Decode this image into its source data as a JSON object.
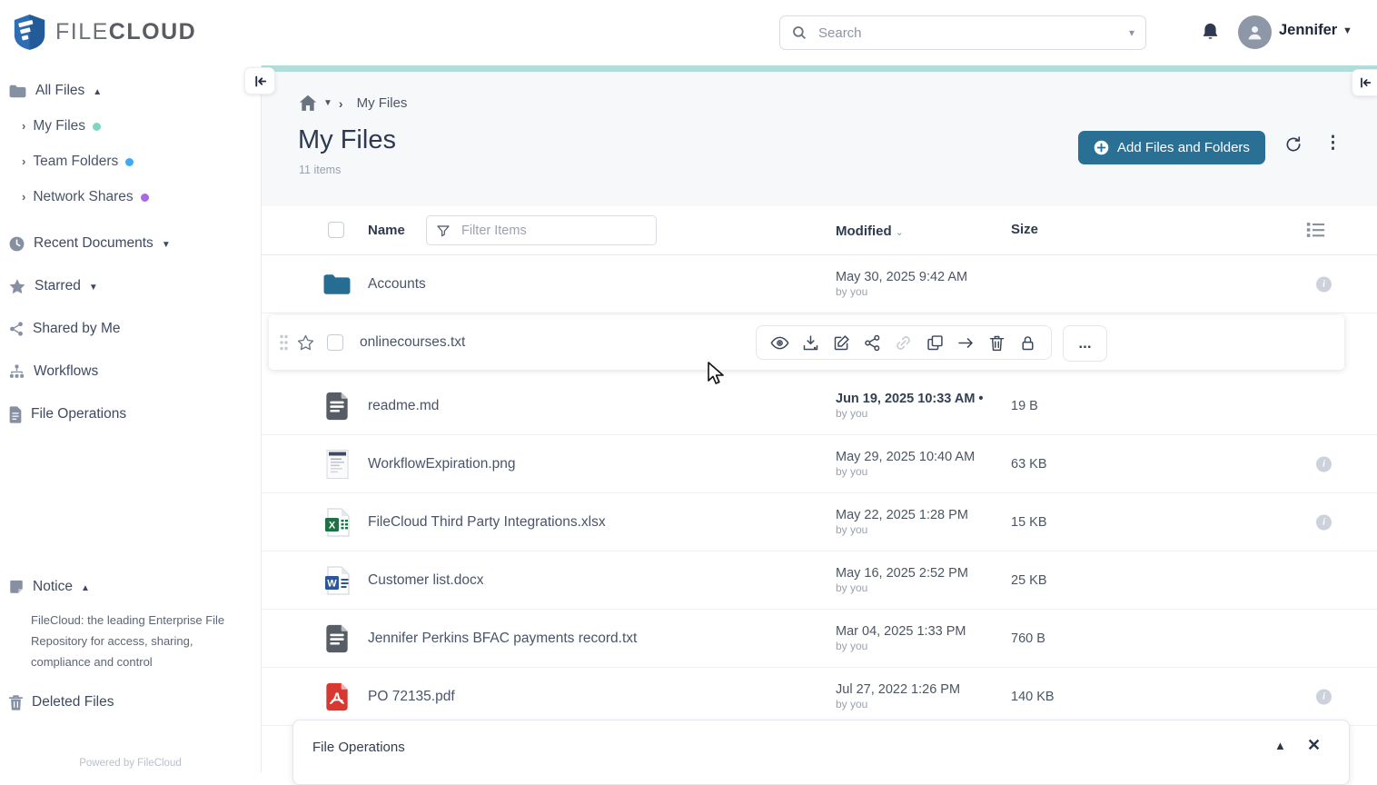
{
  "colors": {
    "primary": "#2a7095",
    "teal_bar": "#b0dfdb",
    "folder_icon": "#256d92"
  },
  "header": {
    "brand_file": "FILE",
    "brand_cloud": "CLOUD",
    "search_placeholder": "Search",
    "user_name": "Jennifer"
  },
  "sidebar": {
    "all_files": {
      "label": "All Files"
    },
    "tree": [
      {
        "label": "My Files",
        "dot": "#7fd6c0"
      },
      {
        "label": "Team Folders",
        "dot": "#3fa9f5"
      },
      {
        "label": "Network Shares",
        "dot": "#a868e8"
      }
    ],
    "items": [
      {
        "label": "Recent Documents"
      },
      {
        "label": "Starred"
      },
      {
        "label": "Shared by Me"
      },
      {
        "label": "Workflows"
      },
      {
        "label": "File Operations"
      }
    ],
    "notice": {
      "label": "Notice",
      "text": "FileCloud: the leading Enterprise File Repository for access, sharing, compliance and control"
    },
    "deleted_files": {
      "label": "Deleted Files"
    },
    "powered_by": "Powered by FileCloud"
  },
  "main": {
    "breadcrumb": {
      "current": "My Files"
    },
    "title": "My Files",
    "item_count": "11 items",
    "add_button_label": "Add Files and Folders",
    "table": {
      "name_header": "Name",
      "filter_placeholder": "Filter Items",
      "modified_header": "Modified",
      "size_header": "Size",
      "row_actions": [
        "preview",
        "download",
        "edit",
        "share",
        "link",
        "copy",
        "move",
        "delete",
        "lock"
      ],
      "more_label": "...",
      "rows": [
        {
          "name": "Accounts",
          "type": "folder",
          "modified": "May 30, 2025 9:42 AM",
          "by": "by you",
          "size": "",
          "info": true
        },
        {
          "name": "onlinecourses.txt",
          "type": "txt",
          "hovered": true
        },
        {
          "name": "readme.md",
          "type": "txt",
          "modified": "Jun 19, 2025 10:33 AM",
          "modified_new": true,
          "by": "by you",
          "size": "19 B",
          "info": false
        },
        {
          "name": "WorkflowExpiration.png",
          "type": "image",
          "modified": "May 29, 2025 10:40 AM",
          "by": "by you",
          "size": "63 KB",
          "info": true
        },
        {
          "name": "FileCloud Third Party Integrations.xlsx",
          "type": "xlsx",
          "modified": "May 22, 2025 1:28 PM",
          "by": "by you",
          "size": "15 KB",
          "info": true
        },
        {
          "name": "Customer list.docx",
          "type": "docx",
          "modified": "May 16, 2025 2:52 PM",
          "by": "by you",
          "size": "25 KB",
          "info": false
        },
        {
          "name": "Jennifer Perkins BFAC payments record.txt",
          "type": "txt",
          "modified": "Mar 04, 2025 1:33 PM",
          "by": "by you",
          "size": "760 B",
          "info": false
        },
        {
          "name": "PO 72135.pdf",
          "type": "pdf",
          "modified": "Jul 27, 2022 1:26 PM",
          "by": "by you",
          "size": "140 KB",
          "info": true
        }
      ]
    },
    "file_operations_panel": {
      "title": "File Operations"
    }
  }
}
